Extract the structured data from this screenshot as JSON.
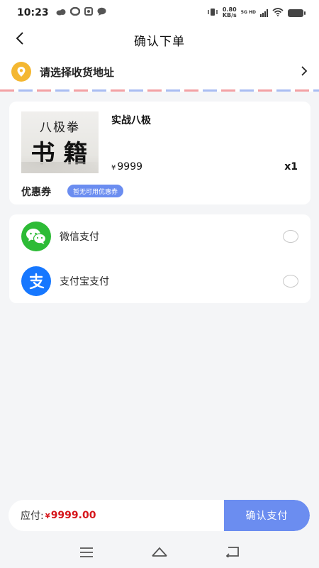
{
  "status_bar": {
    "time": "10:23",
    "net_speed_value": "0.80",
    "net_speed_unit": "KB/s",
    "signal_tags": "5G HD",
    "icons": [
      "cloud-icon",
      "link-icon",
      "photo-icon",
      "chat-icon",
      "vibrate-icon",
      "signal-icon",
      "wifi-icon",
      "battery-icon"
    ]
  },
  "header": {
    "title": "确认下单",
    "back_icon": "chevron-left-icon"
  },
  "address": {
    "label": "请选择收货地址",
    "icon": "location-pin-icon",
    "arrow_icon": "chevron-right-icon",
    "pin_color": "#f4b731"
  },
  "product": {
    "cover_top_text": "八极拳",
    "cover_main_text": "书籍",
    "name": "实战八极",
    "currency": "¥",
    "price": "9999",
    "quantity": "x1"
  },
  "coupon": {
    "label": "优惠券",
    "badge": "暂无可用优惠券"
  },
  "payment": {
    "methods": [
      {
        "label": "微信支付",
        "icon": "wechat-icon",
        "color": "#2dbb36"
      },
      {
        "label": "支付宝支付",
        "icon": "alipay-icon",
        "color": "#1677ff"
      }
    ]
  },
  "footer": {
    "total_label": "应付:",
    "currency": "¥",
    "total_amount": "9999.00",
    "pay_button": "确认支付",
    "accent_color": "#6b8df0",
    "amount_color": "#d6161b"
  },
  "nav_bar": {
    "icons": [
      "menu-icon",
      "home-icon",
      "back-icon"
    ]
  }
}
